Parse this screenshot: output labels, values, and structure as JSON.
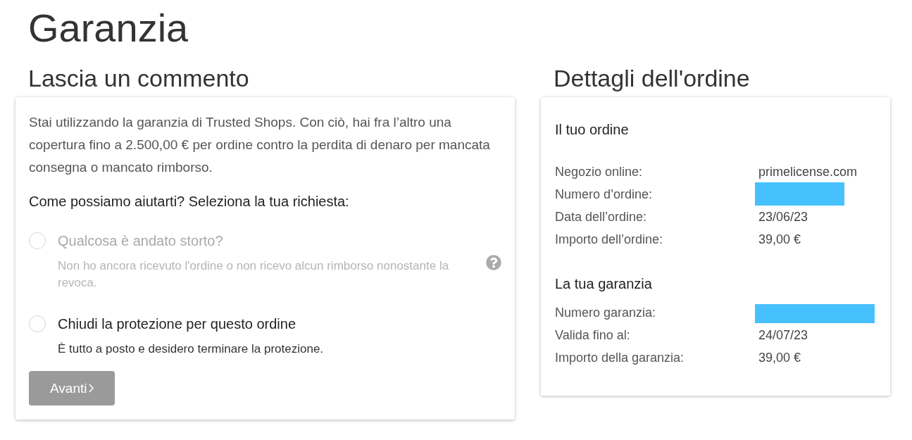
{
  "page": {
    "title": "Garanzia"
  },
  "comment": {
    "heading": "Lascia un commento",
    "intro": "Stai utilizzando la garanzia di Trusted Shops. Con ciò, hai fra l’altro una copertura fino a 2.500,00 € per ordine contro la perdita di denaro per mancata consegna o mancato rimborso.",
    "question": "Come possiamo aiutarti? Seleziona la tua richiesta:",
    "options": [
      {
        "label": "Qualcosa è andato storto?",
        "description": "Non ho ancora ricevuto l'ordine o non ricevo alcun rimborso nonostante la revoca.",
        "selected": false,
        "disabled": true,
        "help": true
      },
      {
        "label": "Chiudi la protezione per questo ordine",
        "description": "È tutto a posto e desidero terminare la protezione.",
        "selected": false,
        "disabled": false,
        "help": false
      }
    ],
    "next_button": {
      "label": "Avanti",
      "disabled": true
    }
  },
  "order_details": {
    "heading": "Dettagli dell'ordine",
    "sections": [
      {
        "title": "Il tuo ordine",
        "rows": [
          {
            "label": "Negozio online:",
            "value": "primelicense.com",
            "redacted": false
          },
          {
            "label": "Numero d’ordine:",
            "redacted": true
          },
          {
            "label": "Data dell’ordine:",
            "value": "23/06/23",
            "redacted": false
          },
          {
            "label": "Importo dell’ordine:",
            "value": "39,00 €",
            "redacted": false
          }
        ]
      },
      {
        "title": "La tua garanzia",
        "rows": [
          {
            "label": "Numero garanzia:",
            "redacted": true
          },
          {
            "label": "Valida fino al:",
            "value": "24/07/23",
            "redacted": false
          },
          {
            "label": "Importo della garanzia:",
            "value": "39,00 €",
            "redacted": false
          }
        ]
      }
    ]
  }
}
